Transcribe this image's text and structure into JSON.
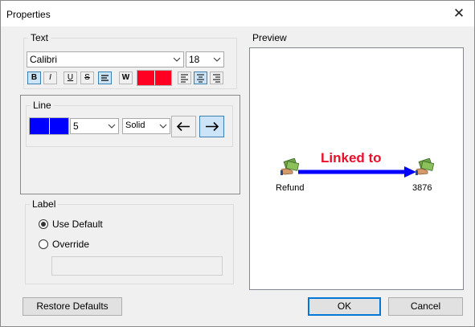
{
  "window": {
    "title": "Properties"
  },
  "text_group": {
    "label": "Text",
    "font": "Calibri",
    "size": "18",
    "buttons": [
      "B",
      "I",
      "U",
      "S",
      "W"
    ],
    "color": "#ff0022"
  },
  "line_group": {
    "label": "Line",
    "color": "#0000ff",
    "width": "5",
    "style": "Solid"
  },
  "label_group": {
    "label": "Label",
    "use_default": "Use Default",
    "override": "Override",
    "selected": "Use Default"
  },
  "preview": {
    "label": "Preview",
    "link_text": "Linked to",
    "source": "Refund",
    "target": "3876",
    "link_color": "#e8102a",
    "arrow_color": "#0000ff"
  },
  "buttons": {
    "restore": "Restore Defaults",
    "ok": "OK",
    "cancel": "Cancel"
  }
}
